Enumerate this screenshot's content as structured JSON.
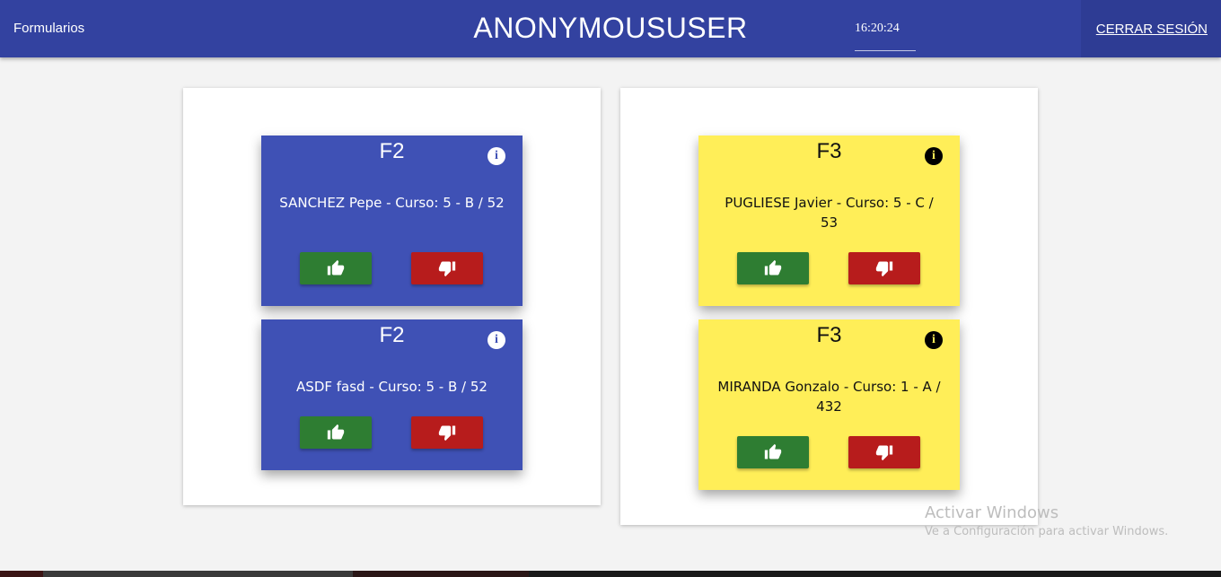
{
  "header": {
    "brand": "Formularios",
    "username": "ANONYMOUSUSER",
    "clock": "16:20:24",
    "logout": "CERRAR SESIÓN"
  },
  "columns": [
    {
      "cards": [
        {
          "code": "F2",
          "description": "SANCHEZ Pepe - Curso: 5 - B / 52",
          "theme": "blue"
        },
        {
          "code": "F2",
          "description": "ASDF fasd - Curso: 5 - B / 52",
          "theme": "blue"
        }
      ]
    },
    {
      "cards": [
        {
          "code": "F3",
          "description": "PUGLIESE Javier - Curso: 5 - C / 53",
          "theme": "yellow"
        },
        {
          "code": "F3",
          "description": "MIRANDA Gonzalo - Curso: 1 - A / 432",
          "theme": "yellow"
        }
      ]
    }
  ],
  "icons": {
    "info": "info-icon",
    "approve": "thumbs-up-icon",
    "reject": "thumbs-down-icon"
  },
  "colors": {
    "header": "#3342a0",
    "card_blue": "#3f51b5",
    "card_yellow": "#ffee58",
    "approve": "#2e7d32",
    "reject": "#b71c1c"
  },
  "watermark": {
    "title": "Activar Windows",
    "subtitle": "Ve a Configuración para activar Windows."
  }
}
